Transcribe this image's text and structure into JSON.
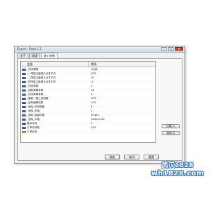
{
  "window": {
    "title": "Expert - Rsdu 1.1",
    "controls": {
      "minimize": "–",
      "maximize": "□",
      "close": "✕"
    }
  },
  "tabs": [
    {
      "label": "关于",
      "active": false
    },
    {
      "label": "常规",
      "active": false
    },
    {
      "label": "输入参数",
      "active": true
    }
  ],
  "grid": {
    "headers": {
      "variable": "变量",
      "value": "数值"
    },
    "rows": [
      {
        "icon": "int-param-icon",
        "name": "_时间周期",
        "value": "5分钟"
      },
      {
        "icon": "int-param-icon",
        "name": "_一带量主盘指几点才平仓",
        "value": "100"
      },
      {
        "icon": "int-param-icon",
        "name": "_二带量主盘指几点才平仓",
        "value": "50"
      },
      {
        "icon": "int-param-icon",
        "name": "_四带量主盘指几点才平仓",
        "value": "-5"
      },
      {
        "icon": "int-param-icon",
        "name": "_均线周期",
        "value": "5"
      },
      {
        "icon": "int-param-icon",
        "name": "_指标周期参数",
        "value": "14"
      },
      {
        "icon": "int-param-icon",
        "name": "_均线周期参数",
        "value": "6"
      },
      {
        "icon": "int-param-icon",
        "name": "_最低一图上的档数",
        "value": "300"
      },
      {
        "icon": "int-param-icon",
        "name": "_信号偏移档数",
        "value": "100"
      },
      {
        "icon": "int-param-icon",
        "name": "_指标_时间周期",
        "value": "6"
      },
      {
        "icon": "int-param-icon",
        "name": "_指标_步值",
        "value": "3"
      },
      {
        "icon": "int-param-icon",
        "name": "_指标_数量价格",
        "value": "Empty"
      },
      {
        "icon": "int-param-icon",
        "name": "_指标_价格",
        "value": "Close price"
      },
      {
        "icon": "int-param-icon",
        "name": "魔术号码",
        "value": "5"
      },
      {
        "icon": "int-param-icon",
        "name": "订单号参数",
        "value": "100"
      },
      {
        "icon": "bool-param-icon",
        "name": "订单反转",
        "value": ""
      }
    ]
  },
  "side_buttons": {
    "load": "加载(L)",
    "save": "保存(S)"
  },
  "footer": {
    "ok": "确定",
    "cancel": "取消",
    "reset": "重置"
  },
  "watermark": {
    "line1": "武汉1828",
    "line2": "wh1828.com"
  }
}
